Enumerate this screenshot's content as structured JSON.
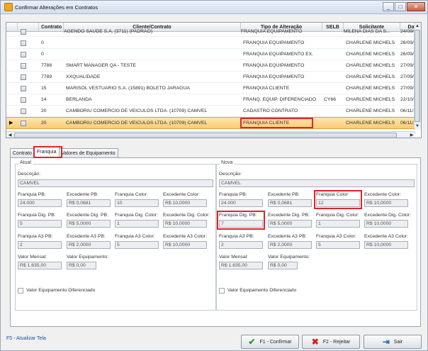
{
  "window": {
    "title": "Confirmar Alterações em Contratos",
    "controls": [
      "_",
      "□",
      "✕"
    ]
  },
  "grid": {
    "columns": [
      "Contrato",
      "Cliente/Contrato",
      "Tipo de Alteração",
      "SELB",
      "Solicitante",
      "Da"
    ],
    "rows": [
      {
        "contrato": "",
        "cliente": "AGENDO SAUDE S.A. (3711) (PADRAO)",
        "tipo": "FRANQUIA EQUIPAMENTO",
        "selb": "",
        "solicitante": "MILENA DIAS DA S...",
        "data": "24/09/2"
      },
      {
        "contrato": "0",
        "cliente": "",
        "tipo": "FRANQUIA EQUIPAMENTO",
        "selb": "",
        "solicitante": "CHARLENE MICHELS",
        "data": "26/09/2"
      },
      {
        "contrato": "0",
        "cliente": "",
        "tipo": "FRANQUIA EQUIPAMENTO EX.",
        "selb": "",
        "solicitante": "CHARLENE MICHELS",
        "data": "26/09/2"
      },
      {
        "contrato": "7788",
        "cliente": "SMART MANAGER QA - TESTE",
        "tipo": "FRANQUIA EQUIPAMENTO",
        "selb": "",
        "solicitante": "CHARLENE MICHELS",
        "data": "27/09/2"
      },
      {
        "contrato": "7789",
        "cliente": "XXQUALIDADE",
        "tipo": "FRANQUIA EQUIPAMENTO",
        "selb": "",
        "solicitante": "CHARLENE MICHELS",
        "data": "27/09/2"
      },
      {
        "contrato": "15",
        "cliente": "MARISOL VESTUARIO S.A. (15891) BOLETO JARAGUA",
        "tipo": "FRANQUIA CLIENTE",
        "selb": "",
        "solicitante": "CHARLENE MICHELS",
        "data": "27/09/2"
      },
      {
        "contrato": "14",
        "cliente": "BERLANDA",
        "tipo": "FRANQ. EQUIP. DIFERENCIADO",
        "selb": "CY66",
        "solicitante": "CHARLENE MICHELS",
        "data": "22/10/2"
      },
      {
        "contrato": "20",
        "cliente": "CAMBORIU COMERCIO DE VEICULOS LTDA. (10709) CAMVEL",
        "tipo": "CADASTRO CONTRATO",
        "selb": "",
        "solicitante": "CHARLENE MICHELS",
        "data": "06/11/2"
      },
      {
        "contrato": "20",
        "cliente": "CAMBORIU COMERCIO DE VEICULOS LTDA. (10709) CAMVEL",
        "tipo": "FRANQUIA CLIENTE",
        "selb": "",
        "solicitante": "CHARLENE MICHELS",
        "data": "06/11/2"
      }
    ]
  },
  "tabs": [
    "Contrato",
    "Franquia",
    "Valores de Equipamento"
  ],
  "atual": {
    "legend": "Atual",
    "descricao_label": "Descrição:",
    "descricao": "CAMVEL",
    "fields": [
      {
        "label": "Franquia PB:",
        "value": "24.000"
      },
      {
        "label": "Excedente PB:",
        "value": "R$ 0,0681"
      },
      {
        "label": "Franquia Color:",
        "value": "10"
      },
      {
        "label": "Excedente Color:",
        "value": "R$ 10,0000"
      },
      {
        "label": "Franquia Dig. PB:",
        "value": "5"
      },
      {
        "label": "Excedente Dig. PB:",
        "value": "R$ 5,0000"
      },
      {
        "label": "Franquia Dig. Color:",
        "value": "1"
      },
      {
        "label": "Excedente Dig. Color:",
        "value": "R$ 10,0000"
      },
      {
        "label": "Franquia A3 PB:",
        "value": "2"
      },
      {
        "label": "Excedente A3 PB:",
        "value": "R$ 2,0000"
      },
      {
        "label": "Franquia A3 Color:",
        "value": "5"
      },
      {
        "label": "Excedente A3 Color:",
        "value": "R$ 10,0000"
      },
      {
        "label": "Valor Mensal:",
        "value": "R$ 1.635,00"
      },
      {
        "label": "Valor Equipamento:",
        "value": "R$ 0,00"
      }
    ],
    "checkbox_label": "Valor Equipamento Diferenciado"
  },
  "nova": {
    "legend": "Nova",
    "descricao_label": "Descrição:",
    "descricao": "CAMVEL",
    "fields": [
      {
        "label": "Franquia PB:",
        "value": "24.000"
      },
      {
        "label": "Excedente PB:",
        "value": "R$ 0,0681"
      },
      {
        "label": "Franquia Color:",
        "value": "12"
      },
      {
        "label": "Excedente Color:",
        "value": "R$ 10,0000"
      },
      {
        "label": "Franquia Dig. PB:",
        "value": "7"
      },
      {
        "label": "Excedente Dig. PB:",
        "value": "R$ 5,0000"
      },
      {
        "label": "Franquia Dig. Color:",
        "value": "1"
      },
      {
        "label": "Excedente Dig. Color:",
        "value": "R$ 10,0000"
      },
      {
        "label": "Franquia A3 PB:",
        "value": "2"
      },
      {
        "label": "Excedente A3 PB:",
        "value": "R$ 2,0000"
      },
      {
        "label": "Franquia A3 Color:",
        "value": "5"
      },
      {
        "label": "Excedente A3 Color:",
        "value": "R$ 10,0000"
      },
      {
        "label": "Valor Mensal:",
        "value": "R$ 1.635,00"
      },
      {
        "label": "Valor Equipamento:",
        "value": "R$ 0,00"
      }
    ],
    "checkbox_label": "Valor Equipamento Diferenciado"
  },
  "footer": {
    "shortcut": "F5 - Atualizar Tela",
    "confirm_label": "F1 - Confirmar",
    "reject_label": "F2 - Rejeitar",
    "exit_label": "Sair"
  },
  "icons": {
    "confirm": "check-icon",
    "reject": "x-icon",
    "exit": "exit-door-icon"
  },
  "colors": {
    "highlight": "#e0242b",
    "selected_row": "#f8cc72",
    "link": "#1a4fa6"
  }
}
